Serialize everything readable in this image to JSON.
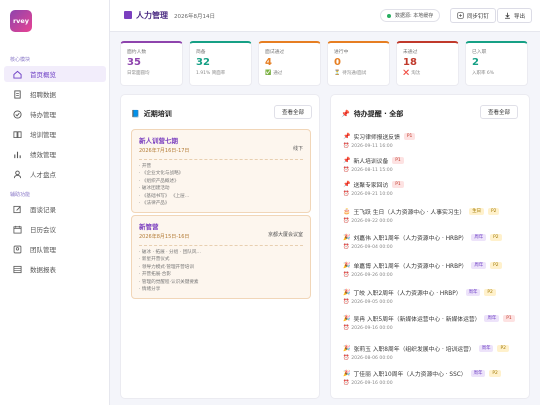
{
  "brand": {
    "logo_text": "rvey"
  },
  "sidebar": {
    "section1": "核心模块",
    "section2": "辅助功能",
    "items": [
      {
        "label": "首页概览",
        "icon": "home-icon",
        "active": true
      },
      {
        "label": "招聘数据",
        "icon": "document-icon"
      },
      {
        "label": "待办管理",
        "icon": "check-circle-icon"
      },
      {
        "label": "培训管理",
        "icon": "book-icon"
      },
      {
        "label": "绩效管理",
        "icon": "bar-chart-icon"
      },
      {
        "label": "人才盘点",
        "icon": "person-icon"
      },
      {
        "label": "面谈记录",
        "icon": "edit-icon"
      },
      {
        "label": "日历会议",
        "icon": "calendar-icon"
      },
      {
        "label": "团队管理",
        "icon": "team-icon"
      },
      {
        "label": "数据报表",
        "icon": "table-icon"
      }
    ]
  },
  "header": {
    "title": "人力管理",
    "date": "2026年8月14日",
    "status": "数据源: 本地缓存",
    "sync_label": "同步钉钉",
    "export_label": "导出"
  },
  "stats": [
    {
      "label": "面约人数",
      "value": "35",
      "sub": "日常面圆均",
      "mark": "",
      "color": "#8e44ad"
    },
    {
      "label": "简备",
      "value": "32",
      "sub": "1.91% 简面率",
      "mark": "",
      "color": "#16a085"
    },
    {
      "label": "面试通过",
      "value": "4",
      "sub": "通过",
      "mark": "✅",
      "color": "#e67e22"
    },
    {
      "label": "进行中",
      "value": "0",
      "sub": "待沟通/面试",
      "mark": "⏳",
      "color": "#e67e22"
    },
    {
      "label": "未通过",
      "value": "18",
      "sub": "淘汰",
      "mark": "❌",
      "color": "#c0392b"
    },
    {
      "label": "已入职",
      "value": "2",
      "sub": "入职率 6%",
      "mark": "",
      "color": "#16a085"
    }
  ],
  "training": {
    "title": "近期培训",
    "view_all": "查看全部",
    "cards": [
      {
        "name": "新人训营七期",
        "date": "2026年7月16日-17日",
        "right": "线下",
        "items": [
          "开营",
          "《企业文化与战略》",
          "《组织产品概述》",
          "破冰团建活动",
          "《基础书写》 《上层…",
          "《法律产品》"
        ]
      },
      {
        "name": "新管营",
        "date": "2026年8月15日-16日",
        "right": "京都大厦会议室",
        "items": [
          "破冰 · 拓展 · 分组 · 团队风…",
          "新星开营仪式",
          "领导力模式·管理开营培训",
          "开营拓展·合影",
          "管理的觉醒程·认识关键要素",
          "情绪分享"
        ]
      }
    ]
  },
  "reminders": {
    "title": "待办提醒 · 全部",
    "view_all": "查看全部",
    "items": [
      {
        "icon": "pin-icon",
        "emoji": "📌",
        "text": "实习律师报送反馈",
        "badges": [
          {
            "t": "P1",
            "k": "p1"
          }
        ],
        "time": "2026-09-11 16:00"
      },
      {
        "icon": "pin-icon",
        "emoji": "📌",
        "text": "新人培训议备",
        "badges": [
          {
            "t": "P1",
            "k": "p1"
          }
        ],
        "time": "2026-08-11 15:00"
      },
      {
        "icon": "pin-icon",
        "emoji": "📌",
        "text": "送聚专家回访",
        "badges": [
          {
            "t": "P1",
            "k": "p1"
          }
        ],
        "time": "2026-09-21 10:00"
      },
      {
        "icon": "cake-icon",
        "emoji": "🎂",
        "text": "王飞跃 生日（人力资源中心 · 人事实习生）",
        "badges": [
          {
            "t": "生日",
            "k": "bday"
          },
          {
            "t": "P2",
            "k": "p2"
          }
        ],
        "time": "2026-09-22 00:00"
      },
      {
        "icon": "party-icon",
        "emoji": "🎉",
        "text": "刘嘉伟 入职1周年（人力资源中心 · HRBP）",
        "badges": [
          {
            "t": "周年",
            "k": "anni"
          },
          {
            "t": "P2",
            "k": "p2"
          }
        ],
        "time": "2026-09-04 00:00"
      },
      {
        "icon": "party-icon",
        "emoji": "🎉",
        "text": "单嘉博 入职1周年（人力资源中心 · HRBP）",
        "badges": [
          {
            "t": "周年",
            "k": "anni"
          },
          {
            "t": "P2",
            "k": "p2"
          }
        ],
        "time": "2026-09-26 00:00"
      },
      {
        "icon": "party-icon",
        "emoji": "🎉",
        "text": "丁皎 入职2周年（人力资源中心 · HRBP）",
        "badges": [
          {
            "t": "周年",
            "k": "anni"
          },
          {
            "t": "P2",
            "k": "p2"
          }
        ],
        "time": "2026-09-05 00:00"
      },
      {
        "icon": "party-icon",
        "emoji": "🎉",
        "text": "吴冉 入职5周年（新媒体运营中心 · 新媒体运营）",
        "badges": [
          {
            "t": "周年",
            "k": "anni"
          },
          {
            "t": "P1",
            "k": "p1"
          }
        ],
        "time": "2026-09-16 00:00"
      },
      {
        "icon": "party-icon",
        "emoji": "🎉",
        "text": "张莉玉 入职8周年（组织发展中心 · 培训运营）",
        "badges": [
          {
            "t": "周年",
            "k": "anni"
          },
          {
            "t": "P2",
            "k": "p2"
          }
        ],
        "time": "2026-08-06 00:00"
      },
      {
        "icon": "party-icon",
        "emoji": "🎉",
        "text": "丁佳丽 入职10周年（人力资源中心 · SSC）",
        "badges": [
          {
            "t": "周年",
            "k": "anni"
          },
          {
            "t": "P2",
            "k": "p2"
          }
        ],
        "time": "2026-09-16 00:00"
      }
    ]
  }
}
